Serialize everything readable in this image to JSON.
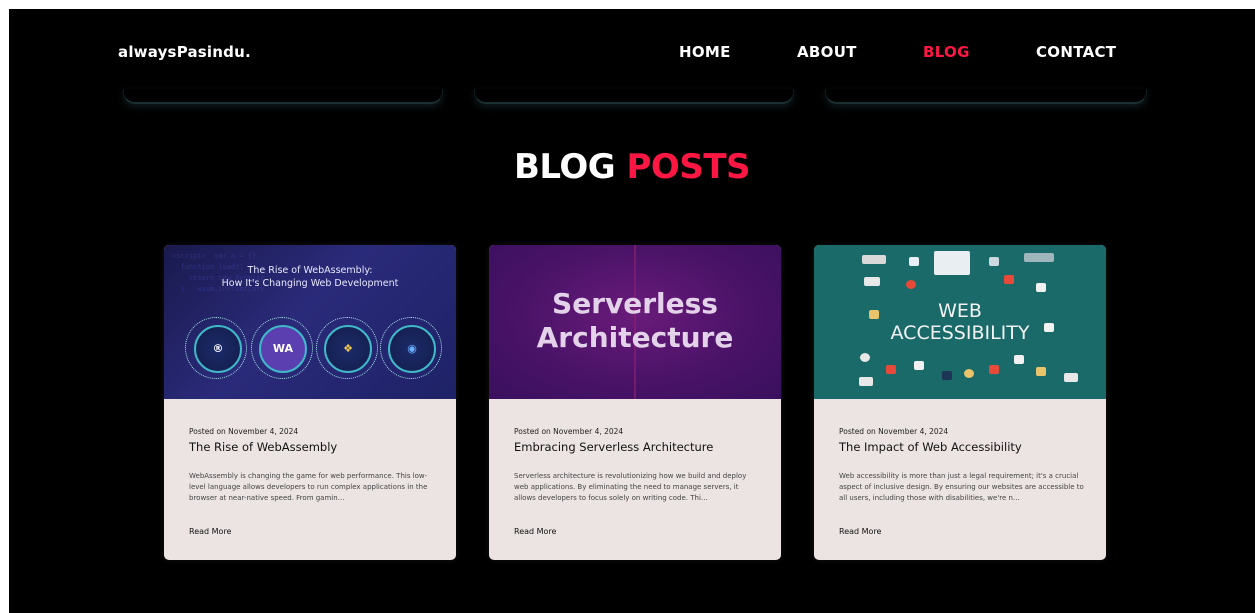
{
  "nav": {
    "logo": "alwaysPasindu.",
    "links": [
      {
        "label": "HOME",
        "active": false
      },
      {
        "label": "ABOUT",
        "active": false
      },
      {
        "label": "BLOG",
        "active": true
      },
      {
        "label": "CONTACT",
        "active": false
      }
    ]
  },
  "section": {
    "title_white": "BLOG",
    "title_red": "POSTS"
  },
  "posts": [
    {
      "thumb_caption_1": "The Rise of WebAssembly:",
      "thumb_caption_2": "How It's Changing Web Development",
      "thumb_badge": "WA",
      "date": "Posted on November 4, 2024",
      "title": "The Rise of WebAssembly",
      "excerpt": "WebAssembly is changing the game for web performance. This low-level language allows developers to run complex applications in the browser at near-native speed. From gamin…",
      "read_more": "Read More"
    },
    {
      "thumb_line_1": "Serverless",
      "thumb_line_2": "Architecture",
      "date": "Posted on November 4, 2024",
      "title": "Embracing Serverless Architecture",
      "excerpt": "Serverless architecture is revolutionizing how we build and deploy web applications. By eliminating the need to manage servers, it allows developers to focus solely on writing code. Thi…",
      "read_more": "Read More"
    },
    {
      "thumb_line_1": "WEB",
      "thumb_line_2": "ACCESSIBILITY",
      "date": "Posted on November 4, 2024",
      "title": "The Impact of Web Accessibility",
      "excerpt": "Web accessibility is more than just a legal requirement; it's a crucial aspect of inclusive design. By ensuring our websites are accessible to all users, including those with disabilities, we're n…",
      "read_more": "Read More"
    }
  ],
  "colors": {
    "background": "#000000",
    "accent": "#ff1744",
    "card": "#ece3e3"
  }
}
